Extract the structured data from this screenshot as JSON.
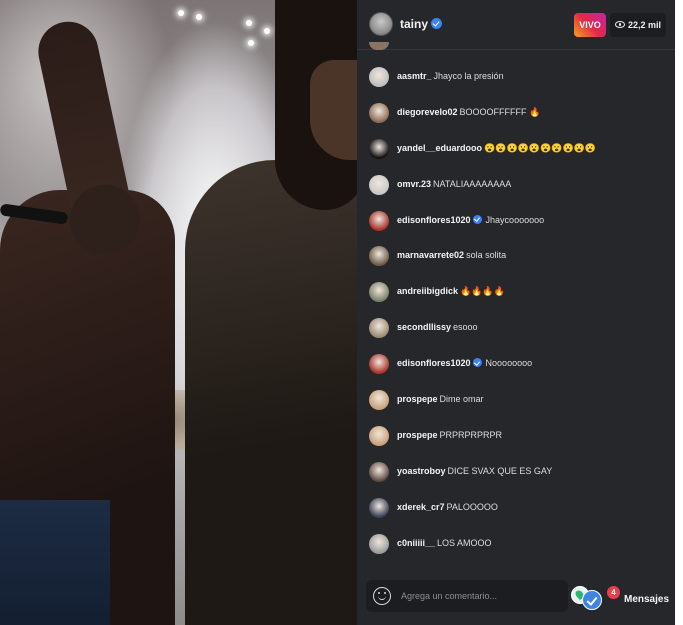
{
  "stream": {
    "host": "tainy",
    "live_label": "VIVO",
    "viewer_count": "22,2 mil"
  },
  "comments": [
    {
      "user": "aasmtr_",
      "text": "Jhayco la presión",
      "verified": false,
      "avatar_color": "#bdbdbd"
    },
    {
      "user": "diegorevelo02",
      "text": "BOOOOFFFFFF 🔥",
      "verified": false,
      "avatar_color": "#8b6a55"
    },
    {
      "user": "yandel__eduardooo",
      "text": "😮😮😮😮😮😮😮😮😮😮",
      "verified": false,
      "avatar_color": "#111111"
    },
    {
      "user": "omvr.23",
      "text": "NATALIAAAAAAAA",
      "verified": false,
      "avatar_color": "#c7c7c7"
    },
    {
      "user": "edisonflores1020",
      "text": "Jhaycooooooo",
      "verified": true,
      "avatar_color": "#a8322b"
    },
    {
      "user": "marnavarrete02",
      "text": "sola solita",
      "verified": false,
      "avatar_color": "#6d5a4a"
    },
    {
      "user": "andreiibigdick",
      "text": "🔥🔥🔥🔥",
      "verified": false,
      "avatar_color": "#7a7f6a"
    },
    {
      "user": "secondllissy",
      "text": "esooo",
      "verified": false,
      "avatar_color": "#9c8a74"
    },
    {
      "user": "edisonflores1020",
      "text": "Noooooooo",
      "verified": true,
      "avatar_color": "#a8322b"
    },
    {
      "user": "prospepe",
      "text": "Dime omar",
      "verified": false,
      "avatar_color": "#c9a07a"
    },
    {
      "user": "prospepe",
      "text": "PRPRPRPRPR",
      "verified": false,
      "avatar_color": "#c9a07a"
    },
    {
      "user": "yoastroboy",
      "text": "DICE SVAX QUE ES GAY",
      "verified": false,
      "avatar_color": "#5d4a44"
    },
    {
      "user": "xderek_cr7",
      "text": "PALOOOOO",
      "verified": false,
      "avatar_color": "#3a3f55"
    },
    {
      "user": "c0niiiii__",
      "text": "LOS AMOOO",
      "verified": false,
      "avatar_color": "#9a9a9a"
    }
  ],
  "composer": {
    "placeholder": "Agrega un comentario..."
  },
  "messages": {
    "label": "Mensajes",
    "badge_count": "4"
  },
  "colors": {
    "panel_bg": "#26272b",
    "verified": "#3b82f6",
    "live_gradient_start": "#f7a21b",
    "live_gradient_end": "#c525a6",
    "notification_badge": "#ed3d4a"
  }
}
